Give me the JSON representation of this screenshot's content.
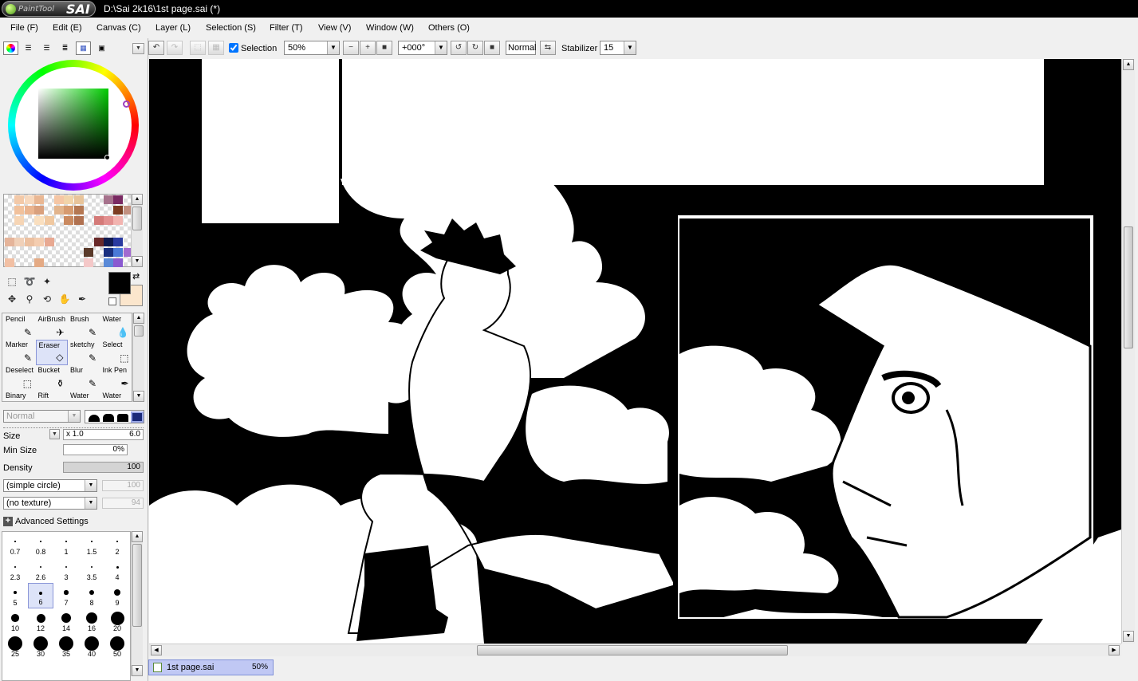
{
  "app": {
    "logo_text_1": "PaintTool",
    "logo_text_2": "SAI",
    "title": "D:\\Sai 2k16\\1st page.sai (*)"
  },
  "menu": [
    {
      "label": "File (F)"
    },
    {
      "label": "Edit (E)"
    },
    {
      "label": "Canvas (C)"
    },
    {
      "label": "Layer (L)"
    },
    {
      "label": "Selection (S)"
    },
    {
      "label": "Filter (T)"
    },
    {
      "label": "View (V)"
    },
    {
      "label": "Window (W)"
    },
    {
      "label": "Others (O)"
    }
  ],
  "toolbar": {
    "selection_label": "Selection",
    "selection_checked": true,
    "zoom": "50%",
    "rotation": "+000°",
    "blend_mode": "Normal",
    "stabilizer_label": "Stabilizer",
    "stabilizer": "15"
  },
  "color": {
    "primary": "#000000",
    "secondary": "#fbe6cd",
    "hue": "#00cc00"
  },
  "swatches": [
    "#f3c9a8",
    "#f7d8bd",
    "#e9b793",
    "#f5c6a4",
    "#f2d4a9",
    "#e8c49a",
    "#a6728c",
    "#7a2a63",
    "#f1c19c",
    "#eab48f",
    "#d9a07d",
    "#e2b48c",
    "#d69a6f",
    "#b47752",
    "#7c3c22",
    "#c29080",
    "#f6d5b5",
    "#fadfbf",
    "#f0c8a0",
    "#ca8a60",
    "#b07150",
    "#d47a78",
    "#e29090",
    "#f2b4b0",
    "#e5b49a",
    "#f4cdb0",
    "#e8a992",
    "#6a2a2a",
    "#101a50",
    "#2a3aa0",
    "#f0d0b8",
    "#ecc0a0",
    "#5a3a2a",
    "#1a3080",
    "#4a7ad8",
    "#a26ad0",
    "#f2c0a4",
    "#e4aa84",
    "#f4c8c8",
    "#5a8ad8",
    "#8a5ad0"
  ],
  "tool_buttons": [
    {
      "icon": "rect-select-icon"
    },
    {
      "icon": "lasso-icon"
    },
    {
      "icon": "magic-wand-icon"
    },
    {
      "icon": "move-icon"
    },
    {
      "icon": "zoom-icon"
    },
    {
      "icon": "rotate-icon"
    },
    {
      "icon": "hand-icon"
    },
    {
      "icon": "eyedropper-icon"
    }
  ],
  "brushes": [
    {
      "label": "Pencil"
    },
    {
      "label": "AirBrush"
    },
    {
      "label": "Brush"
    },
    {
      "label": "Water"
    },
    {
      "label": "Marker"
    },
    {
      "label": "Eraser"
    },
    {
      "label": "sketchy"
    },
    {
      "label": "Select"
    },
    {
      "label": "Deselect"
    },
    {
      "label": "Bucket"
    },
    {
      "label": "Blur"
    },
    {
      "label": "Ink Pen"
    },
    {
      "label": "Binary"
    },
    {
      "label": "Rift"
    },
    {
      "label": "Water"
    },
    {
      "label": "Water"
    }
  ],
  "brush_settings": {
    "mode": "Normal",
    "size_label": "Size",
    "size_mult": "x 1.0",
    "size": "6.0",
    "min_size_label": "Min Size",
    "min_size": "0%",
    "density_label": "Density",
    "density": "100",
    "shape": "(simple circle)",
    "shape_value": "100",
    "texture": "(no texture)",
    "texture_value": "94",
    "advanced_label": "Advanced Settings"
  },
  "brush_sizes": [
    "0.7",
    "0.8",
    "1",
    "1.5",
    "2",
    "2.3",
    "2.6",
    "3",
    "3.5",
    "4",
    "5",
    "6",
    "7",
    "8",
    "9",
    "10",
    "12",
    "14",
    "16",
    "20",
    "25",
    "30",
    "35",
    "40",
    "50"
  ],
  "document": {
    "name": "1st page.sai",
    "zoom": "50%"
  }
}
